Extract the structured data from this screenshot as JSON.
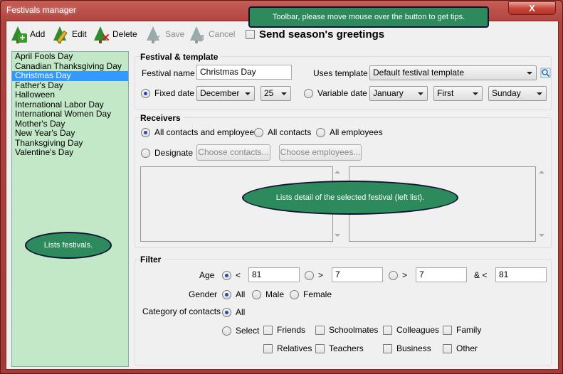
{
  "window": {
    "title": "Festivals manager",
    "close_label": "X"
  },
  "toolbar": {
    "add_label": "Add",
    "edit_label": "Edit",
    "delete_label": "Delete",
    "save_label": "Save",
    "cancel_label": "Cancel",
    "greetings_label": "Send season's greetings",
    "tip": "Toolbar, please move mouse over the button to get tips."
  },
  "festivals": {
    "items": [
      "April Fools Day",
      "Canadian Thanksgiving Day",
      "Christmas Day",
      "Father's Day",
      "Halloween",
      "International Labor Day",
      "International Women Day",
      "Mother's Day",
      "New Year's Day",
      "Thanksgiving Day",
      "Valentine's Day"
    ],
    "selected": "Christmas Day",
    "tip": "Lists festivals."
  },
  "festival_template": {
    "title": "Festival & template",
    "name_label": "Festival name",
    "name_value": "Christmas Day",
    "template_label": "Uses template",
    "template_value": "Default festival template",
    "fixed_date_label": "Fixed date",
    "month_value": "December",
    "day_value": "25",
    "variable_date_label": "Variable date",
    "var_month_value": "January",
    "var_week_value": "First",
    "var_day_value": "Sunday"
  },
  "receivers": {
    "title": "Receivers",
    "all_contacts_employees": "All contacts and employees",
    "all_contacts": "All contacts",
    "all_employees": "All employees",
    "designate": "Designate",
    "choose_contacts": "Choose contacts...",
    "choose_employees": "Choose employees...",
    "tip": "Lists detail of the selected festival (left list)."
  },
  "filter": {
    "title": "Filter",
    "age_label": "Age",
    "lt_symbol": "<",
    "gt_symbol": ">",
    "and_lt_symbol": "& <",
    "age_lt_value": "81",
    "age_gt_value1": "7",
    "age_gt_value2": "7",
    "age_and_lt_value": "81",
    "gender_label": "Gender",
    "gender_all": "All",
    "gender_male": "Male",
    "gender_female": "Female",
    "category_label": "Category of contacts",
    "category_all": "All",
    "category_select": "Select",
    "categories": [
      "Friends",
      "Schoolmates",
      "Colleagues",
      "Family",
      "Relatives",
      "Teachers",
      "Business",
      "Other"
    ]
  }
}
